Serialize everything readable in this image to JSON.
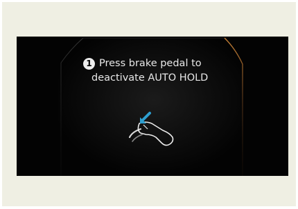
{
  "notice": {
    "step_number": "1",
    "line1": "Press brake pedal to",
    "line2": "deactivate AUTO HOLD"
  },
  "icons": {
    "pedal": "brake-pedal-icon",
    "arrow": "press-arrow-icon"
  },
  "colors": {
    "page_background": "#efefe3",
    "screen_background": "#030303",
    "frame_accent": "#c77a2e",
    "text": "#e8e8e8",
    "arrow": "#2e9fd0"
  }
}
